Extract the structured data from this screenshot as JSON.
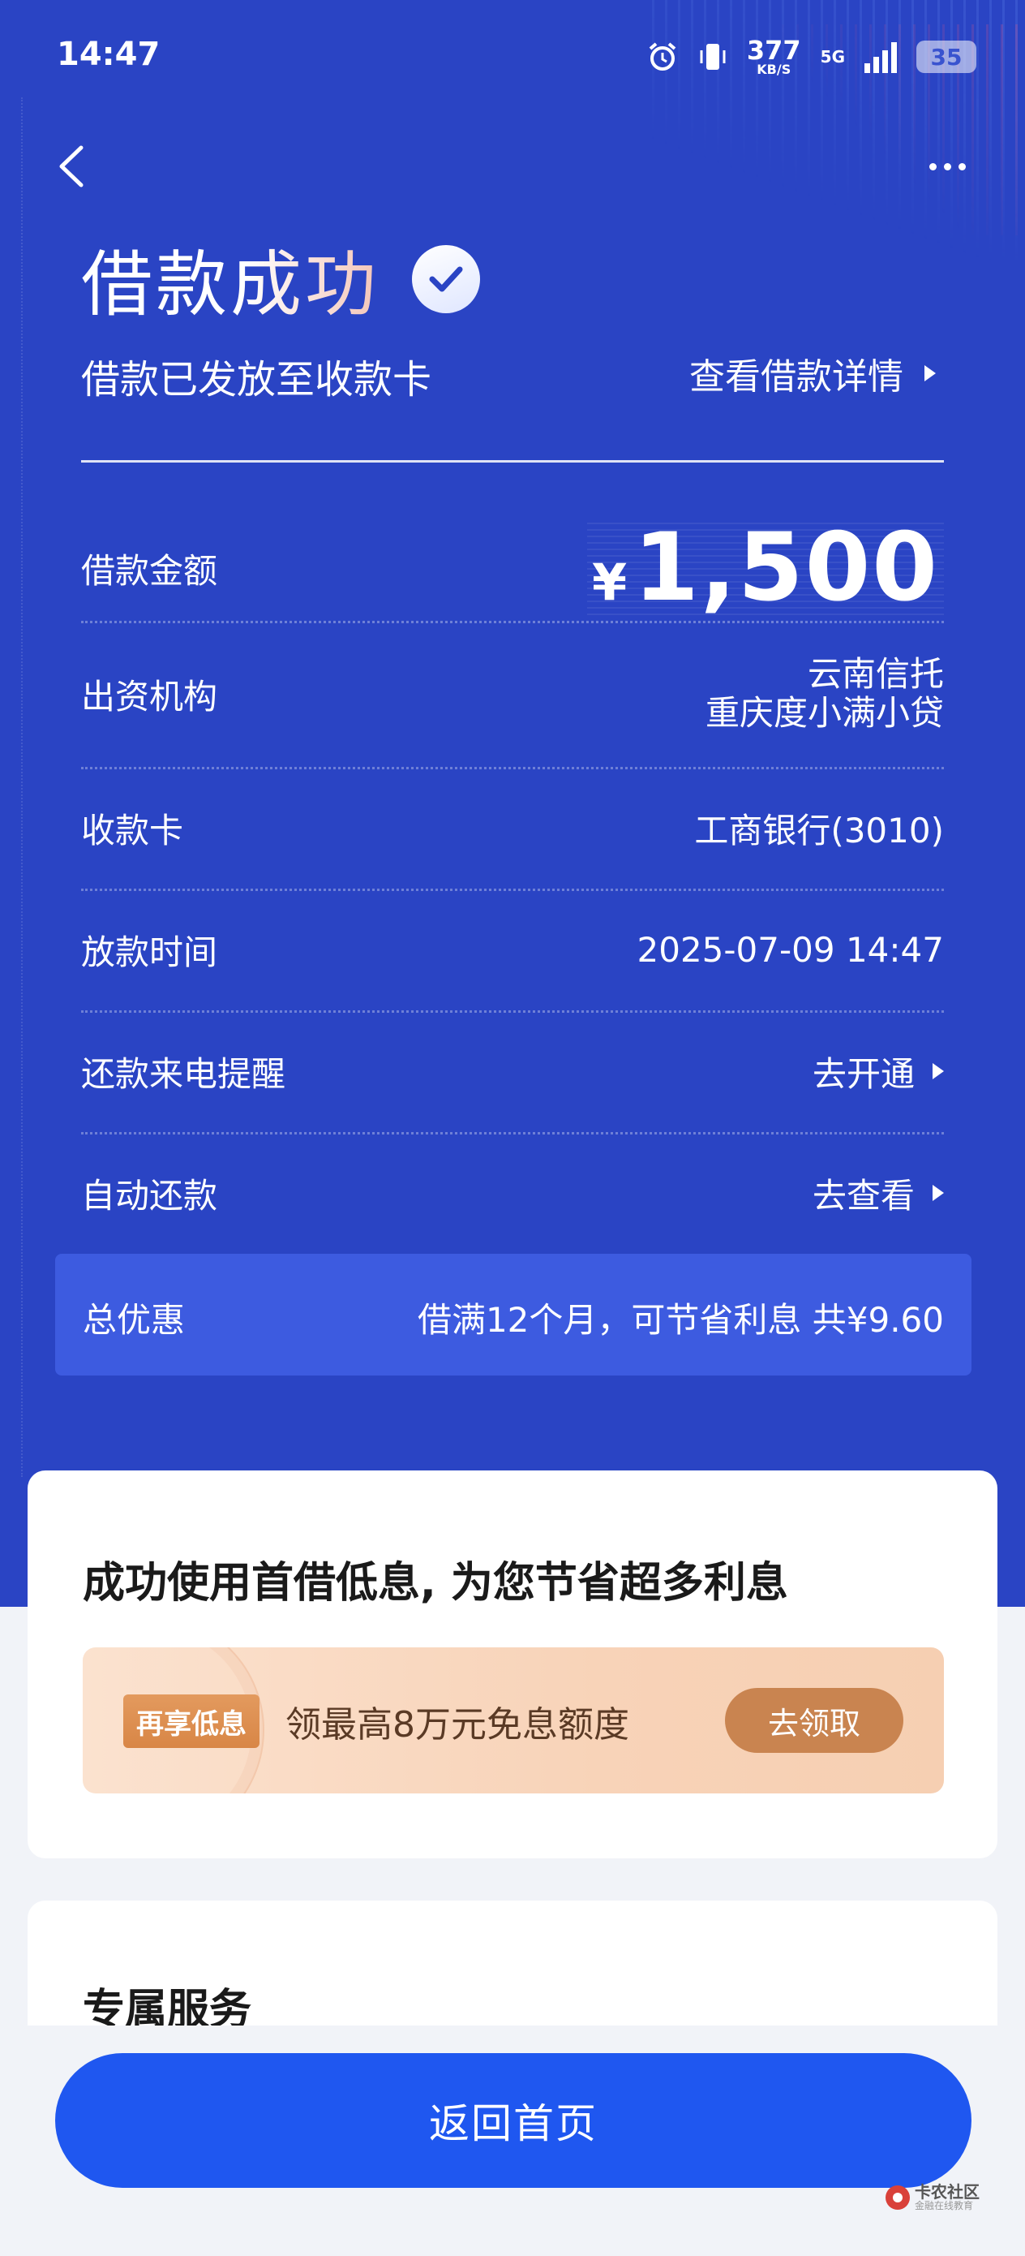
{
  "status_bar": {
    "time": "14:47",
    "net_speed_value": "377",
    "net_speed_unit": "KB/S",
    "network": "5G",
    "battery": "35"
  },
  "header": {
    "title": "借款成功",
    "subtitle": "借款已发放至收款卡",
    "detail_link": "查看借款详情"
  },
  "loan": {
    "amount_label": "借款金额",
    "currency": "¥",
    "amount": "1,500",
    "lender_label": "出资机构",
    "lender_1": "云南信托",
    "lender_2": "重庆度小满小贷",
    "card_label": "收款卡",
    "card_value": "工商银行(3010)",
    "time_label": "放款时间",
    "time_value": "2025-07-09 14:47",
    "reminder_label": "还款来电提醒",
    "reminder_link": "去开通",
    "autopay_label": "自动还款",
    "autopay_link": "去查看",
    "discount_label": "总优惠",
    "discount_value": "借满12个月，可节省利息 共¥9.60"
  },
  "promo": {
    "title": "成功使用首借低息, 为您节省超多利息",
    "tag": "再享低息",
    "text": "领最高8万元免息额度",
    "button": "去领取"
  },
  "service": {
    "title": "专属服务"
  },
  "footer": {
    "home_button": "返回首页",
    "logo_name": "卡农社区",
    "logo_sub": "金融在线教育"
  },
  "colors": {
    "hero_bg": "#2a44c4",
    "primary_button": "#1f57f0",
    "promo_button": "#c98450"
  }
}
